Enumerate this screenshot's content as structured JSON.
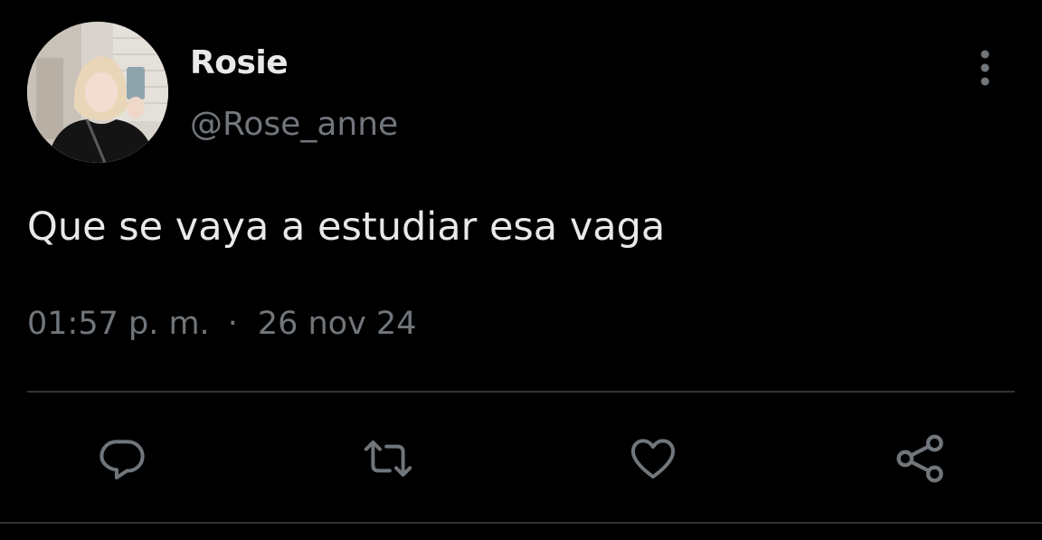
{
  "tweet": {
    "author": {
      "display_name": "Rosie",
      "handle": "@Rose_anne",
      "avatar_icon": "profile-photo"
    },
    "text": "Que se vaya a estudiar esa vaga",
    "time": "01:57 p. m.",
    "separator": "·",
    "date": "26 nov 24"
  },
  "actions": [
    {
      "name": "reply",
      "icon": "reply-icon"
    },
    {
      "name": "retweet",
      "icon": "retweet-icon"
    },
    {
      "name": "like",
      "icon": "heart-icon"
    },
    {
      "name": "share",
      "icon": "share-icon"
    }
  ],
  "colors": {
    "background": "#000000",
    "primary_text": "#e7e9ea",
    "secondary_text": "#71767b",
    "divider": "#2f3336"
  }
}
